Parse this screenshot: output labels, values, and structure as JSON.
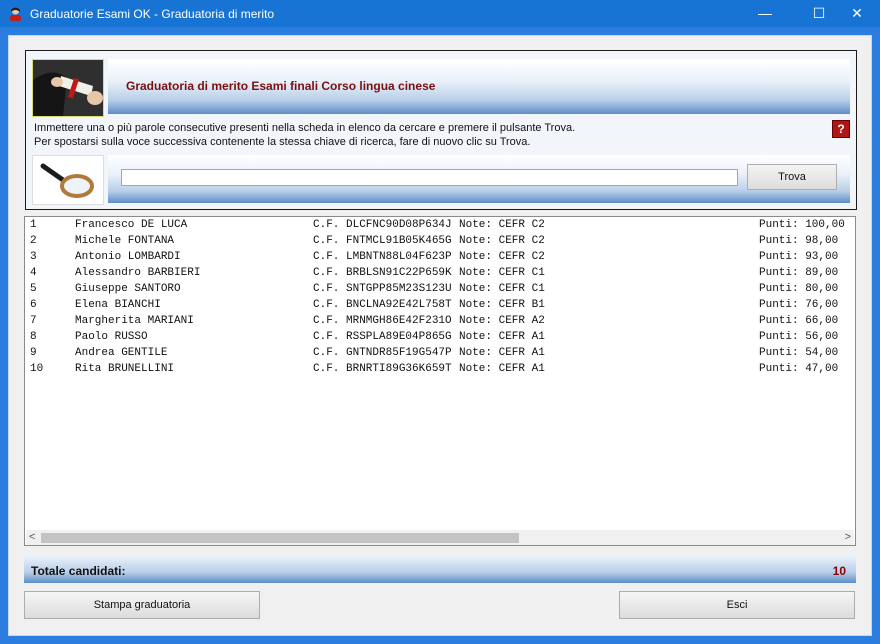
{
  "window": {
    "title": "Graduatorie Esami OK - Graduatoria di merito",
    "minimize": "—",
    "maximize": "☐",
    "close": "✕"
  },
  "header": {
    "banner_title": "Graduatoria di merito Esami finali Corso lingua cinese",
    "instruction_1": "Immettere una o più parole consecutive presenti nella scheda in elenco da cercare e premere il pulsante Trova.",
    "instruction_2": "Per spostarsi sulla voce successiva contenente la stessa chiave di ricerca, fare di nuovo clic su Trova.",
    "help_label": "?"
  },
  "search": {
    "value": "",
    "button_label": "Trova"
  },
  "list": {
    "rows": [
      {
        "num": "1",
        "name": "Francesco DE LUCA",
        "cf": "C.F. DLCFNC90D08P634J",
        "note": "Note: CEFR C2",
        "points": "Punti: 100,00"
      },
      {
        "num": "2",
        "name": "Michele FONTANA",
        "cf": "C.F. FNTMCL91B05K465G",
        "note": "Note: CEFR C2",
        "points": "Punti: 98,00"
      },
      {
        "num": "3",
        "name": "Antonio LOMBARDI",
        "cf": "C.F. LMBNTN88L04F623P",
        "note": "Note: CEFR C2",
        "points": "Punti: 93,00"
      },
      {
        "num": "4",
        "name": "Alessandro BARBIERI",
        "cf": "C.F. BRBLSN91C22P659K",
        "note": "Note: CEFR C1",
        "points": "Punti: 89,00"
      },
      {
        "num": "5",
        "name": "Giuseppe SANTORO",
        "cf": "C.F. SNTGPP85M23S123U",
        "note": "Note: CEFR C1",
        "points": "Punti: 80,00"
      },
      {
        "num": "6",
        "name": "Elena BIANCHI",
        "cf": "C.F. BNCLNA92E42L758T",
        "note": "Note: CEFR B1",
        "points": "Punti: 76,00"
      },
      {
        "num": "7",
        "name": "Margherita MARIANI",
        "cf": "C.F. MRNMGH86E42F231O",
        "note": "Note: CEFR A2",
        "points": "Punti: 66,00"
      },
      {
        "num": "8",
        "name": "Paolo RUSSO",
        "cf": "C.F. RSSPLA89E04P865G",
        "note": "Note: CEFR A1",
        "points": "Punti: 56,00"
      },
      {
        "num": "9",
        "name": "Andrea GENTILE",
        "cf": "C.F. GNTNDR85F19G547P",
        "note": "Note: CEFR A1",
        "points": "Punti: 54,00"
      },
      {
        "num": "10",
        "name": "Rita BRUNELLINI",
        "cf": "C.F. BRNRTI89G36K659T",
        "note": "Note: CEFR A1",
        "points": "Punti: 47,00"
      }
    ],
    "scroll_left": "<",
    "scroll_right": ">"
  },
  "footer": {
    "total_label": "Totale candidati:",
    "total_value": "10",
    "print_label": "Stampa graduatoria",
    "exit_label": "Esci"
  },
  "colors": {
    "titlebar": "#1874d4",
    "banner_title": "#7a1010",
    "total_value": "#8b0000"
  }
}
